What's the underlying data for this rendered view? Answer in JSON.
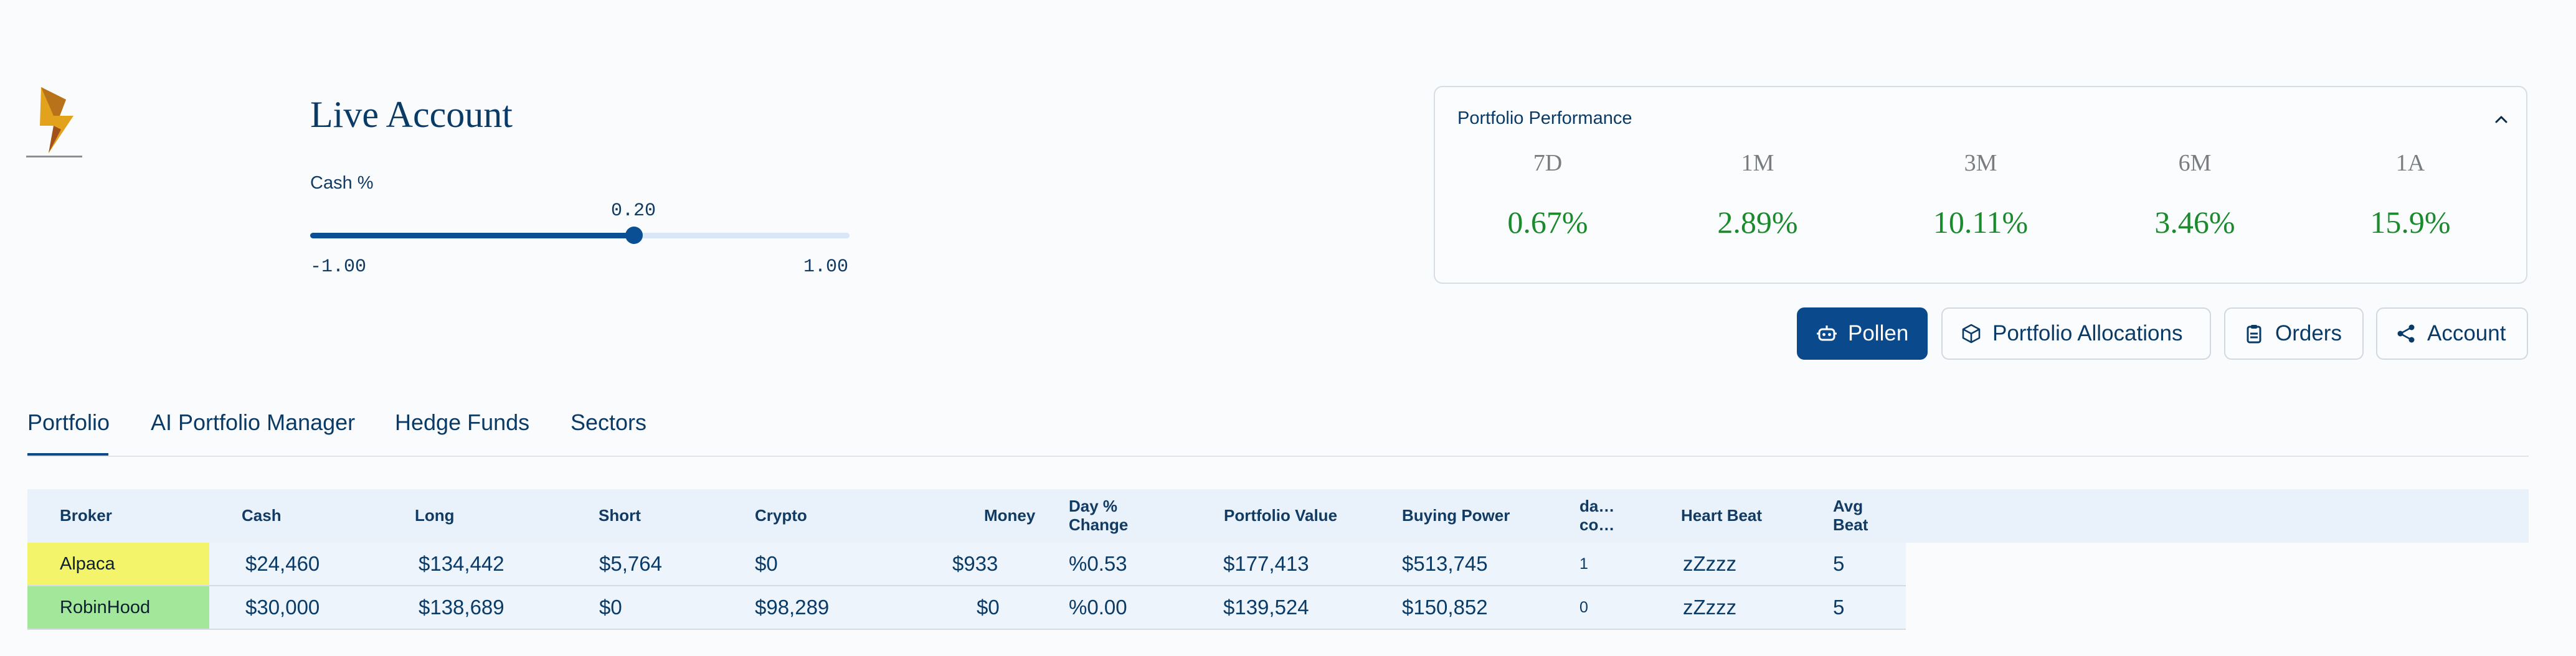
{
  "header": {
    "title": "Live Account",
    "cash_label": "Cash %",
    "slider": {
      "value": 0.2,
      "value_label": "0.20",
      "min_label": "-1.00",
      "max_label": "1.00",
      "min": -1.0,
      "max": 1.0
    }
  },
  "performance": {
    "title": "Portfolio Performance",
    "periods": [
      {
        "label": "7D",
        "value": "0.67%"
      },
      {
        "label": "1M",
        "value": "2.89%"
      },
      {
        "label": "3M",
        "value": "10.11%"
      },
      {
        "label": "6M",
        "value": "3.46%"
      },
      {
        "label": "1A",
        "value": "15.9%"
      }
    ]
  },
  "actions": {
    "pollen": "Pollen",
    "allocations": "Portfolio Allocations",
    "orders": "Orders",
    "account": "Account"
  },
  "tabs": [
    "Portfolio",
    "AI Portfolio Manager",
    "Hedge Funds",
    "Sectors"
  ],
  "table": {
    "headers": {
      "broker": "Broker",
      "cash": "Cash",
      "long": "Long",
      "short": "Short",
      "crypto": "Crypto",
      "money": "Money",
      "day_change_1": "Day %",
      "day_change_2": "Change",
      "portfolio_value": "Portfolio Value",
      "buying_power": "Buying Power",
      "da_1": "da…",
      "da_2": "co…",
      "heart_beat": "Heart Beat",
      "avg_beat_1": "Avg",
      "avg_beat_2": "Beat"
    },
    "rows": [
      {
        "broker": "Alpaca",
        "broker_color": "#f4f46a",
        "cash": "$24,460",
        "long": "$134,442",
        "short": "$5,764",
        "crypto": "$0",
        "money": "$933",
        "day_change": "%0.53",
        "portfolio_value": "$177,413",
        "buying_power": "$513,745",
        "da": "1",
        "heart_beat": "zZzzz",
        "avg_beat": "5"
      },
      {
        "broker": "RobinHood",
        "broker_color": "#a3e89a",
        "cash": "$30,000",
        "long": "$138,689",
        "short": "$0",
        "crypto": "$98,289",
        "money": "$0",
        "day_change": "%0.00",
        "portfolio_value": "$139,524",
        "buying_power": "$150,852",
        "da": "0",
        "heart_beat": "zZzzz",
        "avg_beat": "5"
      }
    ]
  },
  "colors": {
    "accent": "#0a4a8c",
    "positive": "#1a8a2c",
    "text": "#0a3a66"
  },
  "icons": {
    "logo": "flame-logo",
    "pollen": "robot-icon",
    "allocations": "cube-icon",
    "orders": "clipboard-icon",
    "account": "share-icon",
    "collapse": "chevron-up-icon"
  }
}
